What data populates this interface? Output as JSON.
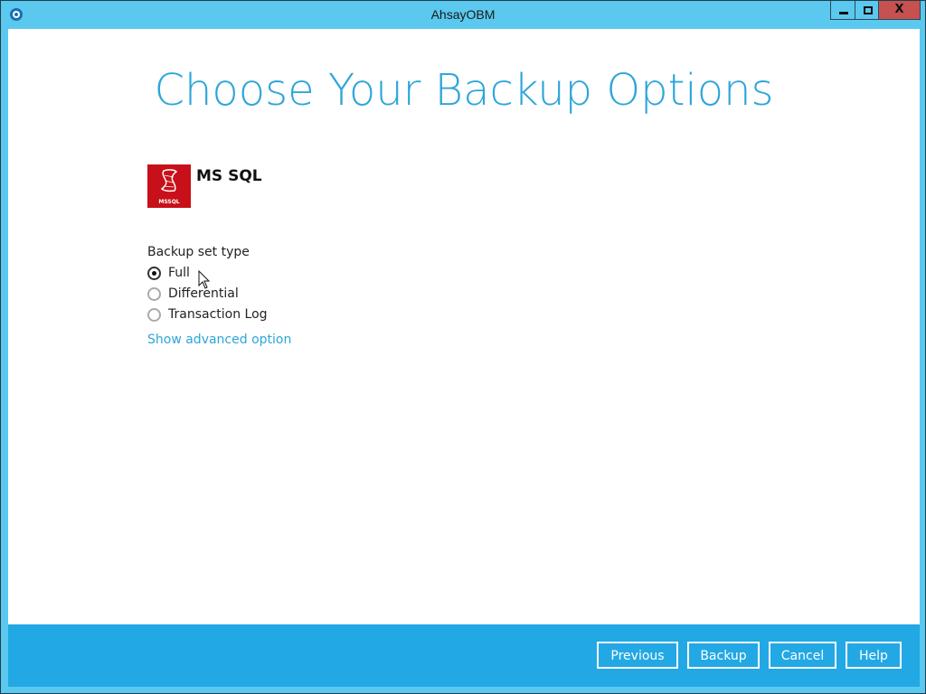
{
  "window": {
    "title": "AhsayOBM",
    "controls": {
      "minimize": "minimize",
      "maximize": "maximize",
      "close": "X"
    }
  },
  "page": {
    "title": "Choose Your Backup Options"
  },
  "product": {
    "icon_label": "MSSQL",
    "name": "MS SQL"
  },
  "backup_set_type": {
    "label": "Backup set type",
    "options": [
      {
        "label": "Full",
        "selected": true
      },
      {
        "label": "Differential",
        "selected": false
      },
      {
        "label": "Transaction Log",
        "selected": false
      }
    ],
    "advanced_link": "Show advanced option"
  },
  "footer": {
    "buttons": {
      "previous": "Previous",
      "backup": "Backup",
      "cancel": "Cancel",
      "help": "Help"
    }
  },
  "colors": {
    "accent": "#2ea6d9",
    "footer_bg": "#22a8e4",
    "titlebar_bg": "#5bc8ef",
    "close_button": "#c75050",
    "mssql_red": "#c8101a"
  }
}
